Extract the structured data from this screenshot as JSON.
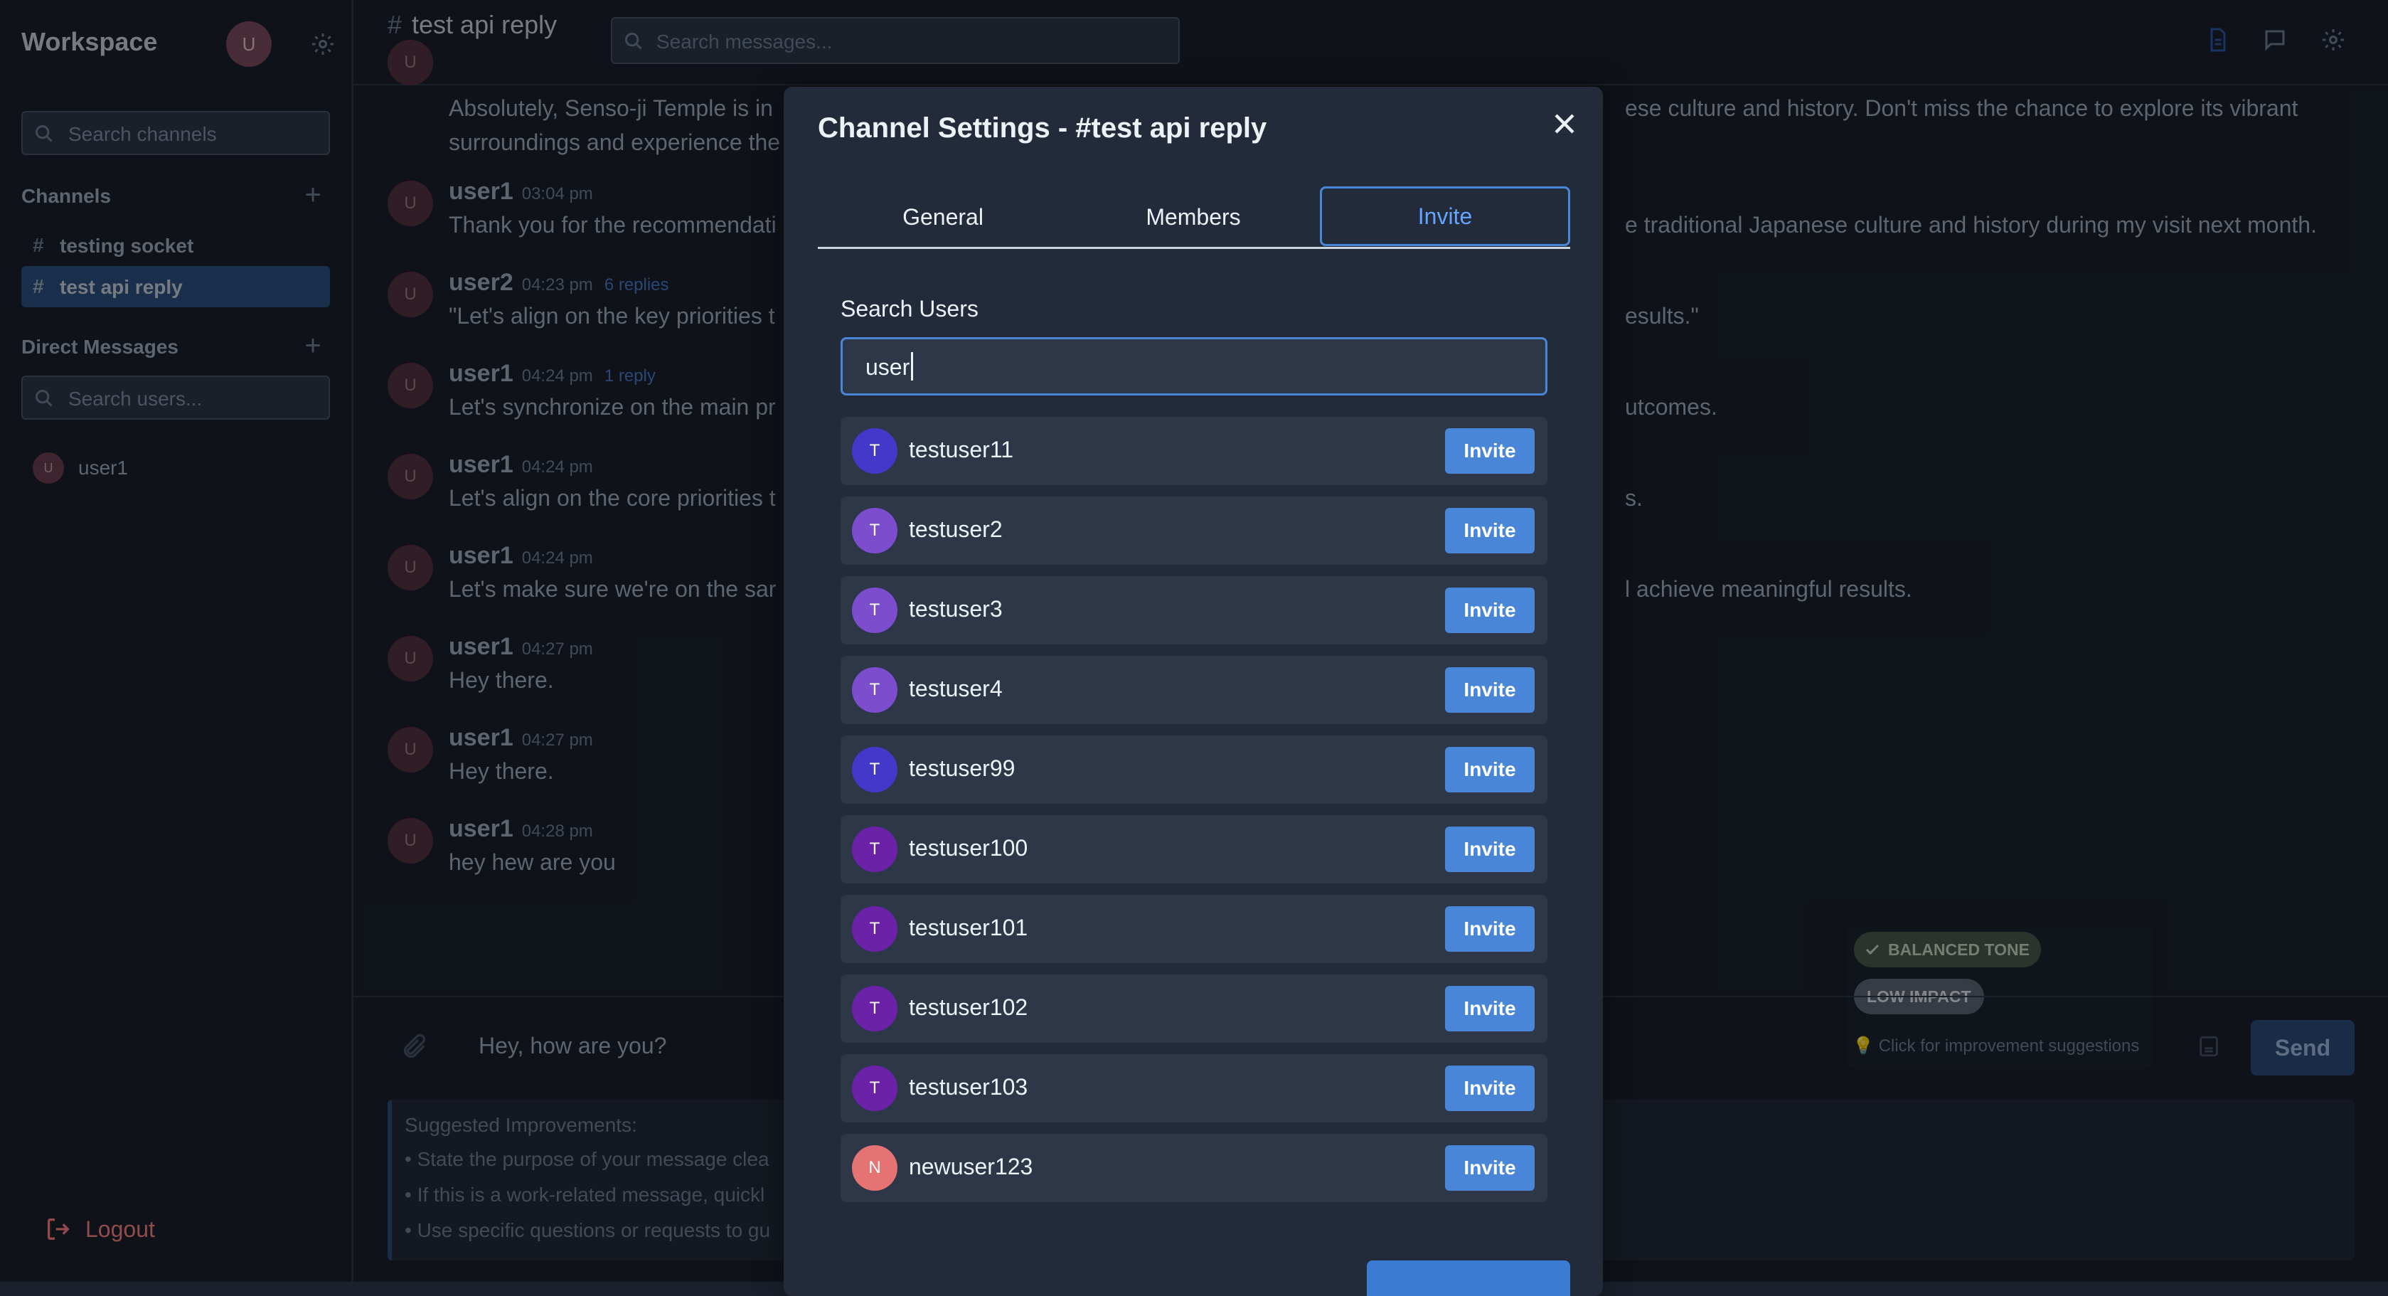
{
  "sidebar": {
    "workspace_title": "Workspace",
    "avatar_initial": "U",
    "channel_search_placeholder": "Search channels",
    "channels_title": "Channels",
    "channels": [
      {
        "label": "testing socket",
        "active": false
      },
      {
        "label": "test api reply",
        "active": true
      }
    ],
    "dm_title": "Direct Messages",
    "user_search_placeholder": "Search users...",
    "dm_users": [
      {
        "initial": "U",
        "name": "user1"
      }
    ],
    "logout_label": "Logout"
  },
  "header": {
    "channel_name": "test api reply",
    "channel_hash": "#",
    "channel_subtitle": "reply",
    "message_search_placeholder": "Search messages..."
  },
  "messages": [
    {
      "user": "",
      "time": "",
      "replies": "",
      "text": "Absolutely, Senso-ji Temple is in",
      "text_right": "ese culture and history. Don't miss the chance to explore its vibrant",
      "text2": "surroundings and experience the"
    },
    {
      "user": "user1",
      "time": "03:04 pm",
      "replies": "",
      "text": "Thank you for the recommendati",
      "text_right": "e traditional Japanese culture and history during my visit next month."
    },
    {
      "user": "user2",
      "time": "04:23 pm",
      "replies": "6 replies",
      "text": "\"Let's align on the key priorities t",
      "text_right": "esults.\""
    },
    {
      "user": "user1",
      "time": "04:24 pm",
      "replies": "1 reply",
      "text": "Let's synchronize on the main pr",
      "text_right": "utcomes."
    },
    {
      "user": "user1",
      "time": "04:24 pm",
      "replies": "",
      "text": "Let's align on the core priorities t",
      "text_right": "s."
    },
    {
      "user": "user1",
      "time": "04:24 pm",
      "replies": "",
      "text": "Let's make sure we're on the sar",
      "text_right": "l achieve meaningful results."
    },
    {
      "user": "user1",
      "time": "04:27 pm",
      "replies": "",
      "text": "Hey there.",
      "text_right": ""
    },
    {
      "user": "user1",
      "time": "04:27 pm",
      "replies": "",
      "text": "Hey there.",
      "text_right": ""
    },
    {
      "user": "user1",
      "time": "04:28 pm",
      "replies": "",
      "text": "hey hew are you",
      "text_right": ""
    }
  ],
  "avatar_initial": "U",
  "composer": {
    "text": "Hey, how are you?",
    "tone_badge": "BALANCED TONE",
    "impact_badge": "LOW IMPACT",
    "suggestion_hint": "Click for improvement suggestions",
    "send_label": "Send"
  },
  "improvements": {
    "title": "Suggested Improvements:",
    "items": [
      "• State the purpose of your message clea",
      "• If this is a work-related message, quickl",
      "• Use specific questions or requests to gu"
    ]
  },
  "modal": {
    "title": "Channel Settings - #test api reply",
    "tabs": [
      {
        "label": "General",
        "active": false
      },
      {
        "label": "Members",
        "active": false
      },
      {
        "label": "Invite",
        "active": true
      }
    ],
    "search_label": "Search Users",
    "search_value": "user",
    "invite_label": "Invite",
    "users": [
      {
        "initial": "T",
        "name": "testuser11",
        "color": "#4338ca"
      },
      {
        "initial": "T",
        "name": "testuser2",
        "color": "#7c4dcc"
      },
      {
        "initial": "T",
        "name": "testuser3",
        "color": "#7c4dcc"
      },
      {
        "initial": "T",
        "name": "testuser4",
        "color": "#7c4dcc"
      },
      {
        "initial": "T",
        "name": "testuser99",
        "color": "#4338ca"
      },
      {
        "initial": "T",
        "name": "testuser100",
        "color": "#6b21a8"
      },
      {
        "initial": "T",
        "name": "testuser101",
        "color": "#6b21a8"
      },
      {
        "initial": "T",
        "name": "testuser102",
        "color": "#6b21a8"
      },
      {
        "initial": "T",
        "name": "testuser103",
        "color": "#6b21a8"
      },
      {
        "initial": "N",
        "name": "newuser123",
        "color": "#e57373"
      }
    ]
  },
  "colors": {
    "accent": "#4a86d8",
    "background": "#1a202c",
    "panel": "#2d3748",
    "logout": "#fc8181"
  }
}
